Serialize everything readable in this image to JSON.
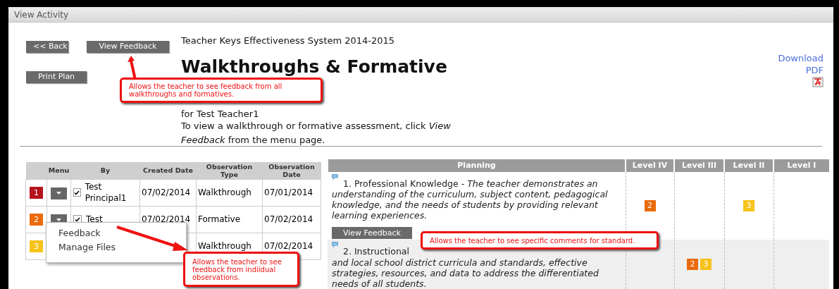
{
  "window": {
    "title": "View Activity"
  },
  "buttons": [
    {
      "kind": "back",
      "label": "<< Back"
    },
    {
      "kind": "feedback",
      "label": "View Feedback"
    },
    {
      "kind": "print",
      "label": "Print Plan"
    }
  ],
  "header": {
    "system": "Teacher Keys Effectiveness System 2014-2015",
    "title": "Walkthroughs & Formative",
    "for": "for Test Teacher1",
    "instructions": "To view a walkthrough or formative assessment, click *View Feedback* from the menu page."
  },
  "download": {
    "label": "Download PDF"
  },
  "observations": {
    "columns": [
      "Menu",
      "By",
      "Created Date",
      "Observation Type",
      "Observation Date"
    ],
    "rows": [
      {
        "number": "1",
        "color": "#b5121b",
        "checked": true,
        "by": "Test Principal1",
        "created": "07/02/2014",
        "type": "Walkthrough",
        "date": "07/01/2014"
      },
      {
        "number": "2",
        "color": "#ea6a0c",
        "checked": true,
        "by": "Test",
        "created": "07/02/2014",
        "type": "Formative",
        "date": "07/02/2014"
      },
      {
        "number": "3",
        "color": "#f7c21a",
        "type": "Walkthrough",
        "date": "07/02/2014"
      }
    ]
  },
  "menu": {
    "items": [
      "Feedback",
      "Manage Files"
    ]
  },
  "planning": {
    "columns": [
      "Planning",
      "Level IV",
      "Level III",
      "Level II",
      "Level I"
    ],
    "standards": [
      {
        "text": "1. Professional Knowledge - *The teacher demonstrates an understanding of the curriculum, subject content, pedagogical knowledge, and the needs of students by providing relevant learning experiences.*",
        "button": "View Feedback",
        "ratings": {
          "level_iv": [
            {
              "number": "2",
              "color": "#ea6a0c"
            }
          ],
          "level_ii": [
            {
              "number": "3",
              "color": "#f7c21a"
            }
          ]
        }
      },
      {
        "text": "2. Instructional",
        "text_continued": "and local school district curricula and standards, effective strategies, resources, and data to address the differentiated needs of all students.",
        "ratings": {
          "level_iii": [
            {
              "number": "2",
              "color": "#ea6a0c"
            },
            {
              "number": "3",
              "color": "#f7c21a"
            }
          ]
        }
      }
    ]
  },
  "callouts": [
    {
      "kind": "buttons",
      "text": "Allows the teacher to see feedback from all walkthroughs and formatives."
    },
    {
      "kind": "menu",
      "text": "Allows the teacher to see feedback from indiidual observations."
    },
    {
      "kind": "standard",
      "text": "Allows the teacher to see specific comments for standard."
    }
  ]
}
